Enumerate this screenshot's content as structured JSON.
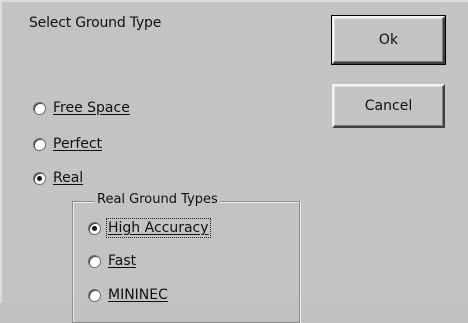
{
  "dialog": {
    "title": "Select Ground Type",
    "ok_label": "Ok",
    "cancel_label": "Cancel"
  },
  "ground_type": {
    "options": [
      "Free Space",
      "Perfect",
      "Real"
    ],
    "selected": "Real"
  },
  "real_ground_types": {
    "title": "Real Ground Types",
    "options": [
      "High Accuracy",
      "Fast",
      "MININEC"
    ],
    "selected": "High Accuracy"
  }
}
